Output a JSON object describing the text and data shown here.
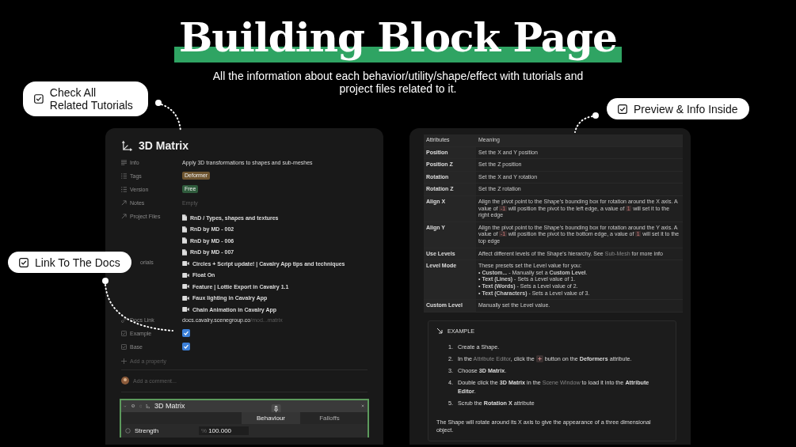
{
  "title": "Building Block Page",
  "subtitle": "All the information about each behavior/utility/shape/effect with tutorials and project files related to it.",
  "callouts": [
    {
      "text": "Check All Related Tutorials"
    },
    {
      "text": "Link To The Docs"
    },
    {
      "text": "Preview & Info Inside"
    }
  ],
  "page_card": {
    "title": "3D Matrix",
    "properties": [
      {
        "kind": "text",
        "label": "Info",
        "value": "Apply 3D transformations to shapes and sub-meshes"
      },
      {
        "kind": "tag",
        "label": "Tags",
        "value": "Deformer",
        "color": "#6e5530"
      },
      {
        "kind": "tag",
        "label": "Version",
        "value": "Free",
        "color": "#2f5b3c"
      },
      {
        "kind": "empty",
        "label": "Notes",
        "value": "Empty"
      },
      {
        "kind": "files",
        "label": "Project Files",
        "items": [
          "RnD / Types, shapes and textures",
          "RnD by MD - 002",
          "RnD by MD - 006",
          "RnD by MD - 007"
        ]
      },
      {
        "kind": "videos",
        "label": "orials",
        "items": [
          "Circles + Script update! | Cavalry App tips and techniques",
          "Float On",
          "Feature | Lottie Export in Cavalry 1.1",
          "Faux lighting in Cavalry App",
          "Chain Animation in Cavalry App"
        ]
      },
      {
        "kind": "link",
        "label": "Docs Link",
        "value": "docs.cavalry.scenegroup.co",
        "value_faded": "/mod...matrix"
      },
      {
        "kind": "checkbox",
        "label": "Example",
        "checked": true
      },
      {
        "kind": "checkbox",
        "label": "Base",
        "checked": true
      }
    ],
    "add_property": "Add a property",
    "comment_placeholder": "Add a comment..."
  },
  "attribute_editor": {
    "title": "3D Matrix",
    "tabs": [
      {
        "label": "Behaviour",
        "selected": true
      },
      {
        "label": "Falloffs",
        "selected": false
      }
    ],
    "rows": [
      {
        "label": "Strength",
        "unit": "%",
        "value": "100.000"
      }
    ]
  },
  "attributes_table": {
    "columns": [
      "Attributes",
      "Meaning"
    ],
    "rows": [
      {
        "name": "Position",
        "meaning": [
          {
            "kind": "text",
            "text": "Set the X and Y position"
          }
        ]
      },
      {
        "name": "Position Z",
        "meaning": [
          {
            "kind": "text",
            "text": "Set the Z position"
          }
        ]
      },
      {
        "name": "Rotation",
        "meaning": [
          {
            "kind": "text",
            "text": "Set the X and Y rotation"
          }
        ]
      },
      {
        "name": "Rotation Z",
        "meaning": [
          {
            "kind": "text",
            "text": "Set the Z rotation"
          }
        ]
      },
      {
        "name": "Align X",
        "meaning": [
          {
            "kind": "text",
            "text": "Align the pivot point to the Shape's bounding box for rotation around the X axis. A value of "
          },
          {
            "kind": "code",
            "text": "-1"
          },
          {
            "kind": "text",
            "text": " will position the pivot to the left edge, a value of "
          },
          {
            "kind": "code",
            "text": "1"
          },
          {
            "kind": "text",
            "text": " will set it to the right edge"
          }
        ]
      },
      {
        "name": "Align Y",
        "meaning": [
          {
            "kind": "text",
            "text": "Align the pivot point to the Shape's bounding box for rotation around the Y axis. A value of "
          },
          {
            "kind": "code",
            "text": "-1"
          },
          {
            "kind": "text",
            "text": " will position the pivot to the bottom edge, a value of "
          },
          {
            "kind": "code",
            "text": "1"
          },
          {
            "kind": "text",
            "text": " will set it to the top edge"
          }
        ]
      },
      {
        "name": "Use Levels",
        "meaning": [
          {
            "kind": "text",
            "text": "Affect different levels of the Shape's hierarchy. See "
          },
          {
            "kind": "link",
            "text": "Sub-Mesh"
          },
          {
            "kind": "text",
            "text": " for more info"
          }
        ]
      },
      {
        "name": "Level Mode",
        "meaning": [
          {
            "kind": "line",
            "text": "These presets set the Level value for you:"
          },
          {
            "kind": "line",
            "text": "• **Custom...** - Manually set a **Custom Level**."
          },
          {
            "kind": "line",
            "text": "• **Text (Lines)** - Sets a Level value of 1."
          },
          {
            "kind": "line",
            "text": "• **Text (Words)** - Sets a Level value of 2."
          },
          {
            "kind": "line",
            "text": "• **Text (Characters)** - Sets a Level value of 3."
          }
        ]
      },
      {
        "name": "Custom Level",
        "meaning": [
          {
            "kind": "text",
            "text": "Manually set the Level value."
          }
        ]
      }
    ]
  },
  "example": {
    "heading": "EXAMPLE",
    "steps": [
      {
        "number": "1.",
        "parts": [
          {
            "kind": "text",
            "text": "Create a Shape."
          }
        ]
      },
      {
        "number": "2.",
        "parts": [
          {
            "kind": "text",
            "text": "In the "
          },
          {
            "kind": "link",
            "text": "Attribute Editor"
          },
          {
            "kind": "text",
            "text": ", click the "
          },
          {
            "kind": "plus"
          },
          {
            "kind": "text",
            "text": " button on the **Deformers** attribute."
          }
        ]
      },
      {
        "number": "3.",
        "parts": [
          {
            "kind": "text",
            "text": "Choose **3D Matrix**."
          }
        ]
      },
      {
        "number": "4.",
        "parts": [
          {
            "kind": "text",
            "text": "Double click the **3D Matrix** in the "
          },
          {
            "kind": "link",
            "text": "Scene Window"
          },
          {
            "kind": "text",
            "text": " to load it into the **Attribute Editor**."
          }
        ]
      },
      {
        "number": "5.",
        "parts": [
          {
            "kind": "text",
            "text": "Scrub the **Rotation X** attribute"
          }
        ]
      }
    ],
    "note": "The Shape will rotate around its X axis to give the appearance of a three dimensional object."
  }
}
